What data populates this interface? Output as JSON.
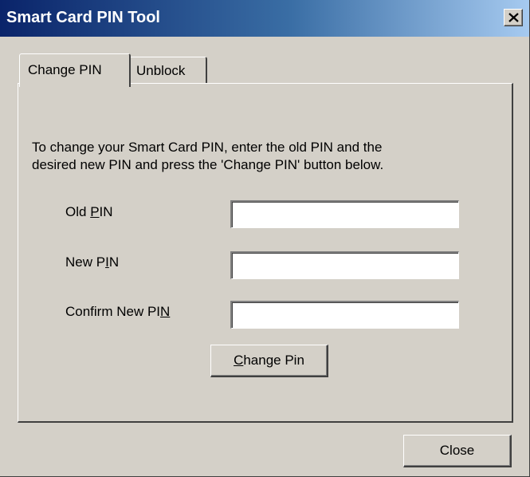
{
  "window": {
    "title": "Smart Card PIN Tool",
    "close_icon": "close-x-icon"
  },
  "tabs": [
    {
      "label": "Change PIN",
      "active": true
    },
    {
      "label": "Unblock",
      "active": false
    }
  ],
  "change_pin": {
    "instructions_line1": "To change your Smart Card PIN, enter the old PIN and the",
    "instructions_line2": "desired new PIN and press the 'Change PIN' button below.",
    "old_pin": {
      "label_pre": "Old ",
      "label_mnemonic": "P",
      "label_post": "IN",
      "value": ""
    },
    "new_pin": {
      "label_pre": "New P",
      "label_mnemonic": "I",
      "label_post": "N",
      "value": ""
    },
    "confirm_pin": {
      "label_pre": "Confirm New PI",
      "label_mnemonic": "N",
      "label_post": "",
      "value": ""
    },
    "button": {
      "label_mnemonic": "C",
      "label_post": "hange Pin"
    }
  },
  "footer": {
    "close_label": "Close"
  },
  "colors": {
    "face": "#d4d0c8",
    "title_start": "#0a246a",
    "title_end": "#a6caf0",
    "title_text": "#ffffff"
  }
}
